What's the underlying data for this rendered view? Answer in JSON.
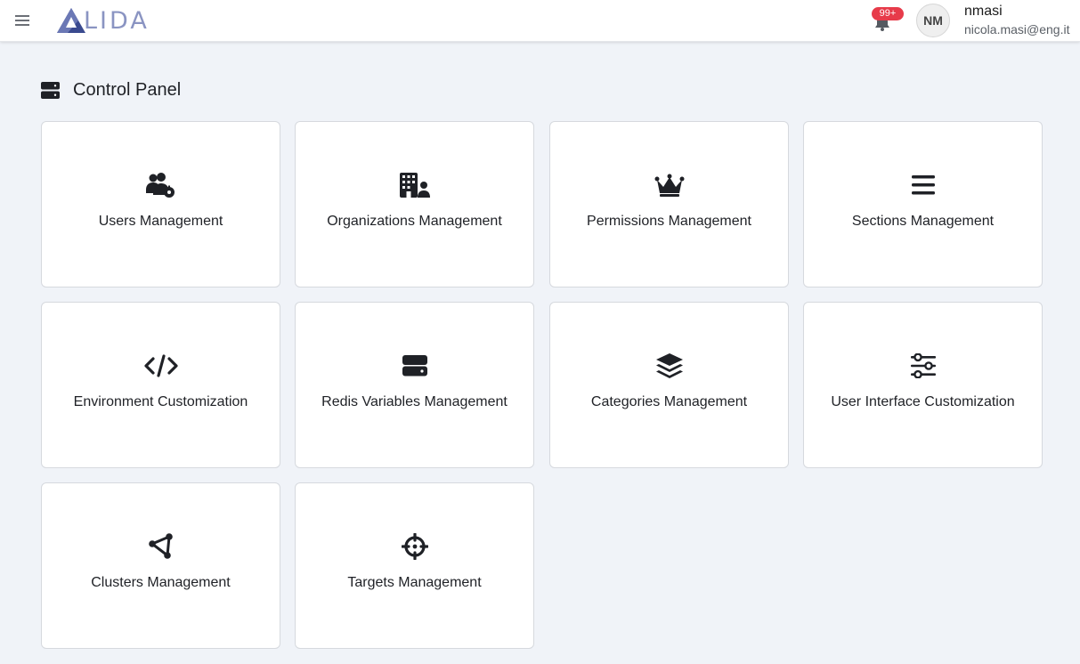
{
  "header": {
    "logo_text": "LIDA",
    "notifications_badge": "99+",
    "user": {
      "initials": "NM",
      "username": "nmasi",
      "email": "nicola.masi@eng.it"
    }
  },
  "page": {
    "title": "Control Panel"
  },
  "cards": [
    {
      "label": "Users Management",
      "icon": "users-gear-icon"
    },
    {
      "label": "Organizations Management",
      "icon": "building-user-icon"
    },
    {
      "label": "Permissions Management",
      "icon": "crown-icon"
    },
    {
      "label": "Sections Management",
      "icon": "bars-icon"
    },
    {
      "label": "Environment Customization",
      "icon": "code-icon"
    },
    {
      "label": "Redis Variables Management",
      "icon": "server-icon"
    },
    {
      "label": "Categories Management",
      "icon": "layers-icon"
    },
    {
      "label": "User Interface Customization",
      "icon": "sliders-icon"
    },
    {
      "label": "Clusters Management",
      "icon": "nodes-icon"
    },
    {
      "label": "Targets Management",
      "icon": "crosshairs-icon"
    }
  ]
}
